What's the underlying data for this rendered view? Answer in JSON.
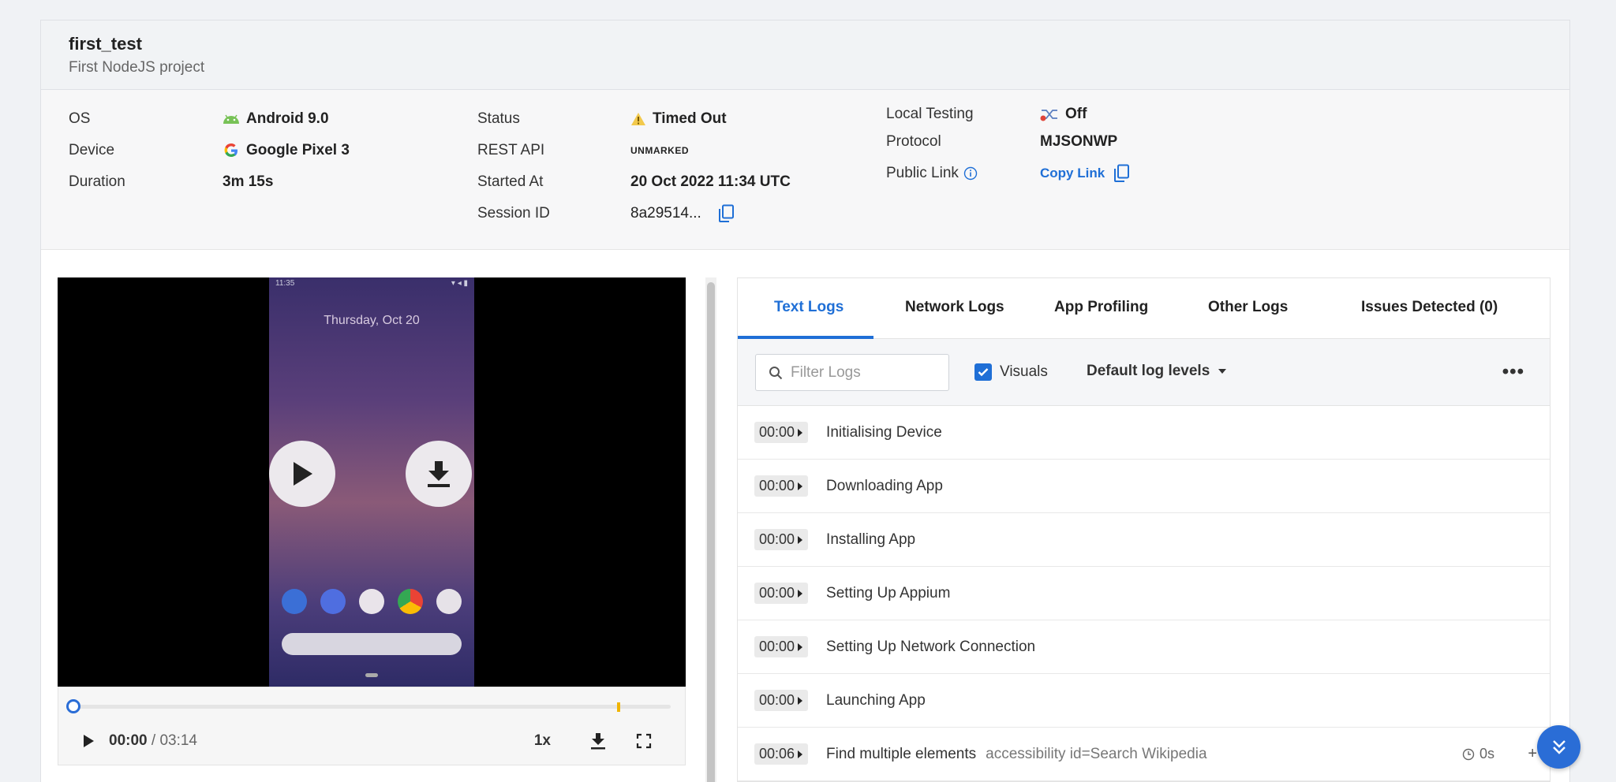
{
  "header": {
    "title": "first_test",
    "subtitle": "First NodeJS project"
  },
  "meta": {
    "os_label": "OS",
    "os_value": "Android 9.0",
    "device_label": "Device",
    "device_value": "Google Pixel 3",
    "duration_label": "Duration",
    "duration_value": "3m 15s",
    "status_label": "Status",
    "status_value": "Timed Out",
    "rest_label": "REST API",
    "rest_value": "UNMARKED",
    "started_label": "Started At",
    "started_value": "20 Oct 2022 11:34 UTC",
    "session_label": "Session ID",
    "session_value": "8a29514...",
    "local_label": "Local Testing",
    "local_value": "Off",
    "protocol_label": "Protocol",
    "protocol_value": "MJSONWP",
    "public_label": "Public Link",
    "copy_link": "Copy Link"
  },
  "video": {
    "status_time": "11:35",
    "phone_date": "Thursday, Oct 20",
    "current_time": "00:00",
    "separator": " / ",
    "total_time": "03:14",
    "speed": "1x",
    "progress": 0.0
  },
  "tabs": [
    "Text Logs",
    "Network Logs",
    "App Profiling",
    "Other Logs",
    "Issues Detected (0)"
  ],
  "toolbar": {
    "filter_placeholder": "Filter Logs",
    "visuals_label": "Visuals",
    "levels_label": "Default log levels",
    "more": "•••"
  },
  "logs": [
    {
      "time": "00:00",
      "message": "Initialising Device"
    },
    {
      "time": "00:00",
      "message": "Downloading App"
    },
    {
      "time": "00:00",
      "message": "Installing App"
    },
    {
      "time": "00:00",
      "message": "Setting Up Appium"
    },
    {
      "time": "00:00",
      "message": "Setting Up Network Connection"
    },
    {
      "time": "00:00",
      "message": "Launching App"
    },
    {
      "time": "00:06",
      "message": "Find multiple elements",
      "detail": "accessibility id=Search Wikipedia",
      "duration": "0s"
    }
  ],
  "colors": {
    "accent": "#1f6fd6",
    "warning": "#f2c94c",
    "android": "#78c257"
  }
}
